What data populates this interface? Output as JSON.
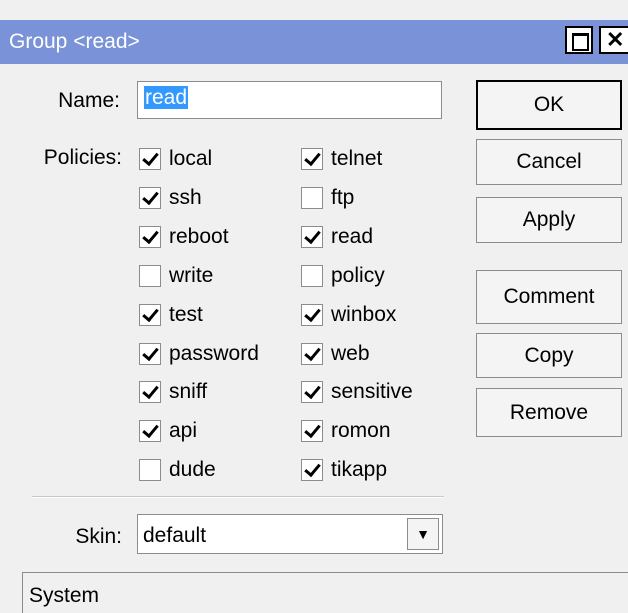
{
  "window": {
    "title": "Group <read>"
  },
  "form": {
    "name_label": "Name:",
    "name_value": "read",
    "policies_label": "Policies:",
    "skin_label": "Skin:",
    "skin_value": "default"
  },
  "policies_left": [
    {
      "label": "local",
      "checked": true
    },
    {
      "label": "ssh",
      "checked": true
    },
    {
      "label": "reboot",
      "checked": true
    },
    {
      "label": "write",
      "checked": false
    },
    {
      "label": "test",
      "checked": true
    },
    {
      "label": "password",
      "checked": true
    },
    {
      "label": "sniff",
      "checked": true
    },
    {
      "label": "api",
      "checked": true
    },
    {
      "label": "dude",
      "checked": false
    }
  ],
  "policies_right": [
    {
      "label": "telnet",
      "checked": true
    },
    {
      "label": "ftp",
      "checked": false
    },
    {
      "label": "read",
      "checked": true
    },
    {
      "label": "policy",
      "checked": false
    },
    {
      "label": "winbox",
      "checked": true
    },
    {
      "label": "web",
      "checked": true
    },
    {
      "label": "sensitive",
      "checked": true
    },
    {
      "label": "romon",
      "checked": true
    },
    {
      "label": "tikapp",
      "checked": true
    }
  ],
  "buttons": {
    "ok": "OK",
    "cancel": "Cancel",
    "apply": "Apply",
    "comment": "Comment",
    "copy": "Copy",
    "remove": "Remove"
  },
  "status": {
    "text": "System"
  }
}
